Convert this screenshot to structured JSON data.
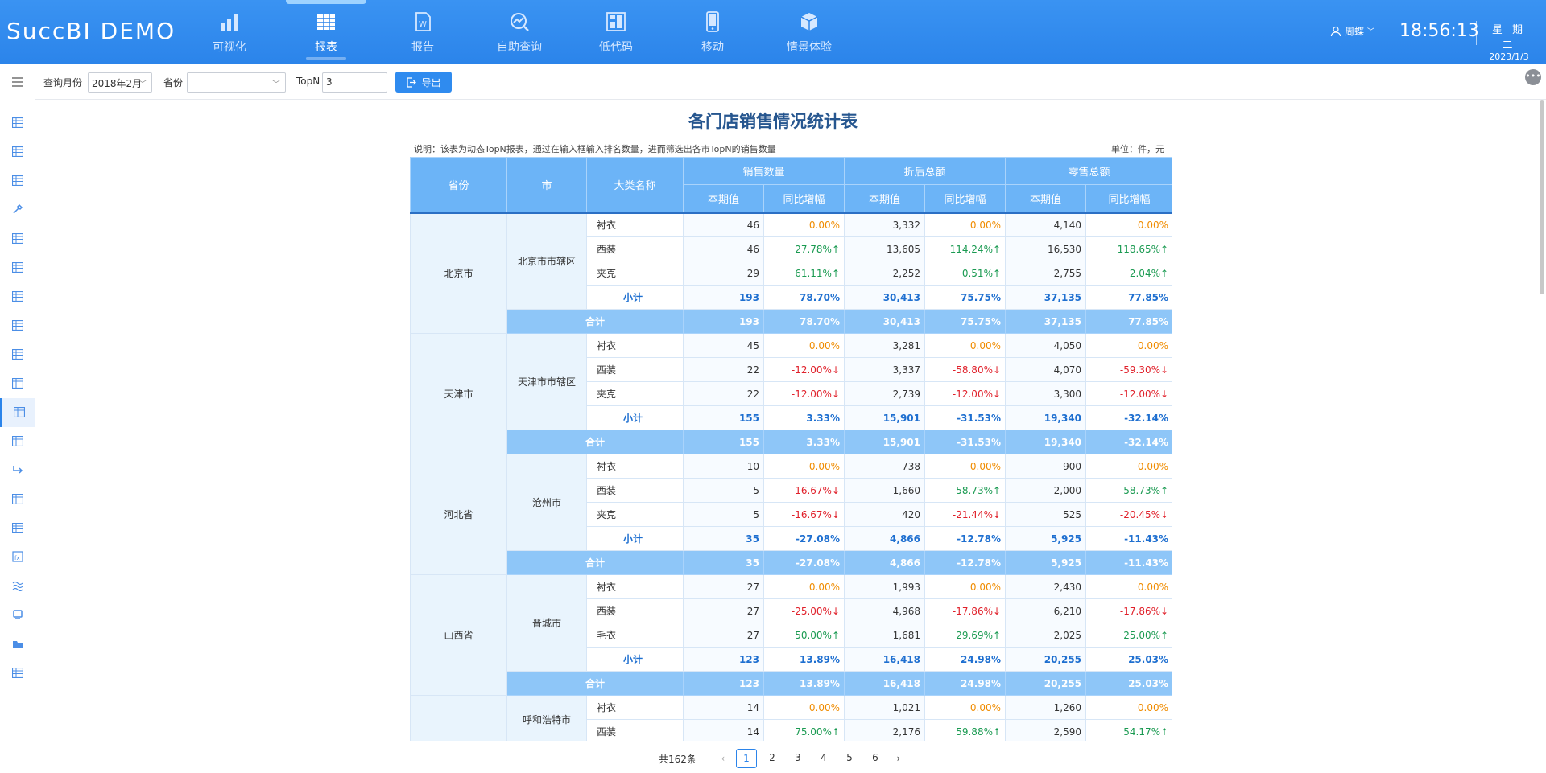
{
  "app": {
    "logo": "SuccBI DEMO"
  },
  "nav": [
    {
      "label": "可视化",
      "icon": "bar-chart-icon"
    },
    {
      "label": "报表",
      "icon": "table-grid-icon",
      "active": true
    },
    {
      "label": "报告",
      "icon": "word-doc-icon"
    },
    {
      "label": "自助查询",
      "icon": "query-chart-icon"
    },
    {
      "label": "低代码",
      "icon": "low-code-icon"
    },
    {
      "label": "移动",
      "icon": "mobile-icon"
    },
    {
      "label": "情景体验",
      "icon": "cube-icon"
    }
  ],
  "user": {
    "name": "周蝶"
  },
  "clock": {
    "time": "18:56:13",
    "weekday": "星 期 二",
    "date": "2023/1/3"
  },
  "filters": {
    "month_label": "查询月份",
    "month_value": "2018年2月",
    "province_label": "省份",
    "province_value": "",
    "topn_label": "TopN",
    "topn_value": "3",
    "export_label": "导出"
  },
  "report": {
    "title": "各门店销售情况统计表",
    "note": "说明：该表为动态TopN报表，通过在输入框输入排名数量，进而筛选出各市TopN的销售数量",
    "unit": "单位：件，元",
    "headers": {
      "province": "省份",
      "city": "市",
      "category": "大类名称",
      "qty": "销售数量",
      "discount": "折后总额",
      "retail": "零售总额",
      "current": "本期值",
      "yoy": "同比增幅"
    },
    "subtotal_label": "小计",
    "total_label": "合计",
    "groups": [
      {
        "province": "北京市",
        "city": "北京市市辖区",
        "rows": [
          [
            "衬衣",
            "46",
            "0.00%",
            "3,332",
            "0.00%",
            "4,140",
            "0.00%"
          ],
          [
            "西装",
            "46",
            "27.78%↑",
            "13,605",
            "114.24%↑",
            "16,530",
            "118.65%↑"
          ],
          [
            "夹克",
            "29",
            "61.11%↑",
            "2,252",
            "0.51%↑",
            "2,755",
            "2.04%↑"
          ]
        ],
        "subtotal": [
          "193",
          "78.70%",
          "30,413",
          "75.75%",
          "37,135",
          "77.85%"
        ],
        "total": [
          "193",
          "78.70%",
          "30,413",
          "75.75%",
          "37,135",
          "77.85%"
        ]
      },
      {
        "province": "天津市",
        "city": "天津市市辖区",
        "rows": [
          [
            "衬衣",
            "45",
            "0.00%",
            "3,281",
            "0.00%",
            "4,050",
            "0.00%"
          ],
          [
            "西装",
            "22",
            "-12.00%↓",
            "3,337",
            "-58.80%↓",
            "4,070",
            "-59.30%↓"
          ],
          [
            "夹克",
            "22",
            "-12.00%↓",
            "2,739",
            "-12.00%↓",
            "3,300",
            "-12.00%↓"
          ]
        ],
        "subtotal": [
          "155",
          "3.33%",
          "15,901",
          "-31.53%",
          "19,340",
          "-32.14%"
        ],
        "total": [
          "155",
          "3.33%",
          "15,901",
          "-31.53%",
          "19,340",
          "-32.14%"
        ]
      },
      {
        "province": "河北省",
        "city": "沧州市",
        "rows": [
          [
            "衬衣",
            "10",
            "0.00%",
            "738",
            "0.00%",
            "900",
            "0.00%"
          ],
          [
            "西装",
            "5",
            "-16.67%↓",
            "1,660",
            "58.73%↑",
            "2,000",
            "58.73%↑"
          ],
          [
            "夹克",
            "5",
            "-16.67%↓",
            "420",
            "-21.44%↓",
            "525",
            "-20.45%↓"
          ]
        ],
        "subtotal": [
          "35",
          "-27.08%",
          "4,866",
          "-12.78%",
          "5,925",
          "-11.43%"
        ],
        "total": [
          "35",
          "-27.08%",
          "4,866",
          "-12.78%",
          "5,925",
          "-11.43%"
        ]
      },
      {
        "province": "山西省",
        "city": "晋城市",
        "rows": [
          [
            "衬衣",
            "27",
            "0.00%",
            "1,993",
            "0.00%",
            "2,430",
            "0.00%"
          ],
          [
            "西装",
            "27",
            "-25.00%↓",
            "4,968",
            "-17.86%↓",
            "6,210",
            "-17.86%↓"
          ],
          [
            "毛衣",
            "27",
            "50.00%↑",
            "1,681",
            "29.69%↑",
            "2,025",
            "25.00%↑"
          ]
        ],
        "subtotal": [
          "123",
          "13.89%",
          "16,418",
          "24.98%",
          "20,255",
          "25.03%"
        ],
        "total": [
          "123",
          "13.89%",
          "16,418",
          "24.98%",
          "20,255",
          "25.03%"
        ]
      },
      {
        "province": "",
        "city": "呼和浩特市",
        "rows": [
          [
            "衬衣",
            "14",
            "0.00%",
            "1,021",
            "0.00%",
            "1,260",
            "0.00%"
          ],
          [
            "西装",
            "14",
            "75.00%↑",
            "2,176",
            "59.88%↑",
            "2,590",
            "54.17%↑"
          ]
        ]
      }
    ]
  },
  "pager": {
    "total": "共162条",
    "pages": [
      "1",
      "2",
      "3",
      "4",
      "5",
      "6"
    ],
    "current": "1"
  },
  "sidebar_icons": [
    "menu-icon",
    "table-icon",
    "table-icon",
    "excel-icon",
    "tools-icon",
    "calendar-table-icon",
    "table-icon",
    "table-icon",
    "table-icon",
    "table-icon",
    "table-icon",
    "table-icon",
    "form-icon",
    "flow-icon",
    "table-icon",
    "grid-table-icon",
    "formula-icon",
    "wave-icon",
    "device-icon",
    "folder-icon",
    "doc-icon"
  ]
}
